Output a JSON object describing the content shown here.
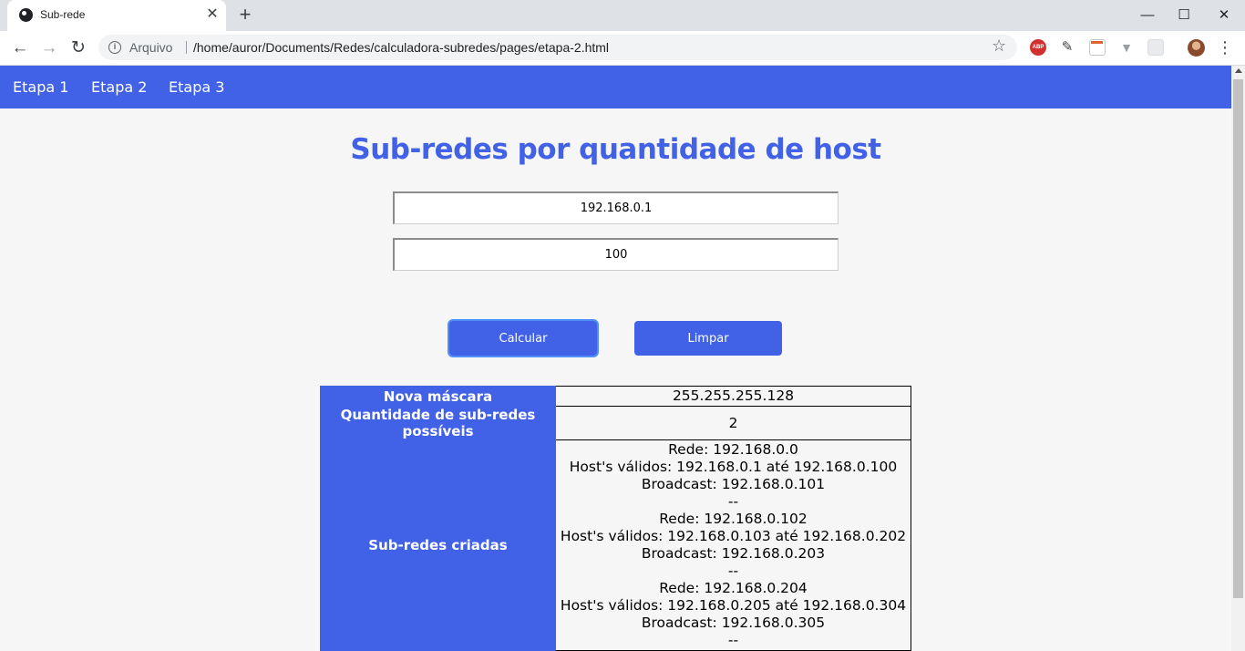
{
  "browser": {
    "tab_title": "Sub-rede",
    "tab_close": "✕",
    "new_tab": "+",
    "window_controls": [
      "—",
      "☐",
      "✕"
    ],
    "nav_back": "←",
    "nav_forward": "→",
    "nav_reload": "↻",
    "omnibox_label": "Arquivo",
    "omnibox_url": "/home/auror/Documents/Redes/calculadora-subredes/pages/etapa-2.html",
    "extensions": [
      "adblock-plus-icon",
      "eyedropper-icon",
      "calendar-icon",
      "vuejs-devtools-icon",
      "extension-icon"
    ],
    "abp_label": "ABP"
  },
  "nav": {
    "items": [
      "Etapa 1",
      "Etapa 2",
      "Etapa 3"
    ]
  },
  "page": {
    "title": "Sub-redes por quantidade de host",
    "ip_value": "192.168.0.1",
    "hosts_value": "100",
    "calc_label": "Calcular",
    "clear_label": "Limpar",
    "accent_color": "#4161e6"
  },
  "results": {
    "mask_label": "Nova máscara",
    "mask_value": "255.255.255.128",
    "count_label": "Quantidade de sub-redes possíveis",
    "count_value": "2",
    "subnets_label": "Sub-redes criadas",
    "subnet_lines": [
      "Rede: 192.168.0.0",
      "Host's válidos: 192.168.0.1 até 192.168.0.100",
      "Broadcast: 192.168.0.101",
      "--",
      "Rede: 192.168.0.102",
      "Host's válidos: 192.168.0.103 até 192.168.0.202",
      "Broadcast: 192.168.0.203",
      "--",
      "Rede: 192.168.0.204",
      "Host's válidos: 192.168.0.205 até 192.168.0.304",
      "Broadcast: 192.168.0.305",
      "--"
    ]
  }
}
